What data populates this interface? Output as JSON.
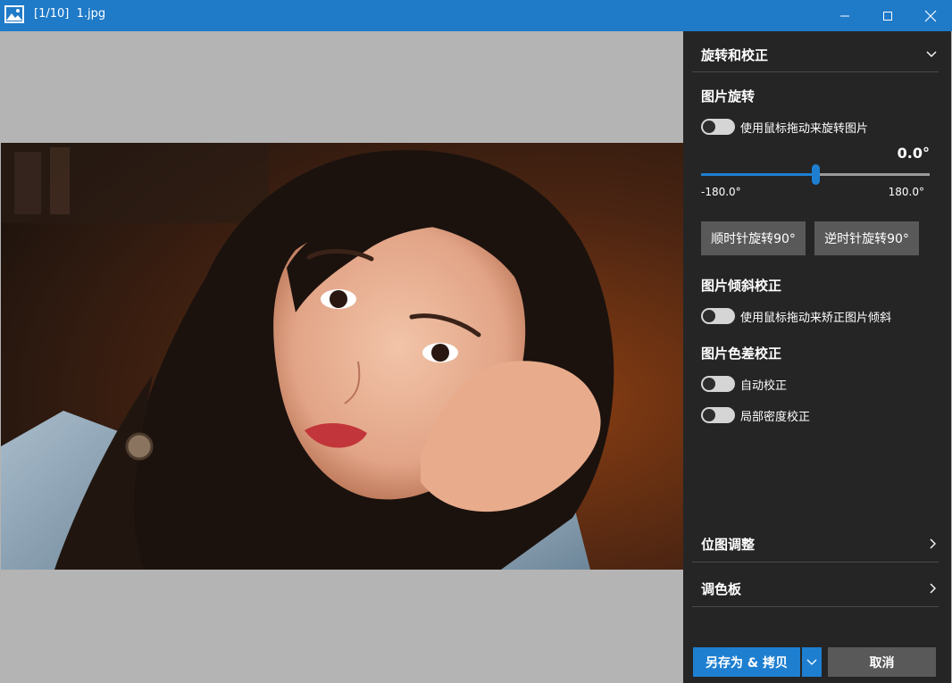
{
  "window": {
    "counter": "[1/10]",
    "filename": "1.jpg",
    "icons": {
      "app": "image-icon",
      "minimize": "minimize-icon",
      "maximize": "maximize-icon",
      "close": "close-icon"
    }
  },
  "colors": {
    "titlebar": "#1f7ac8",
    "accent": "#1e7fd1",
    "panel": "#252526",
    "button": "#595959",
    "viewer_bg": "#b4b4b4"
  },
  "panel": {
    "rotate_section": {
      "title": "旋转和校正",
      "expanded": true,
      "rotation": {
        "title": "图片旋转",
        "mouse_toggle_label": "使用鼠标拖动来旋转图片",
        "mouse_toggle_on": false,
        "angle_display": "0.0°",
        "angle": 0.0,
        "min_label": "-180.0°",
        "max_label": "180.0°",
        "min": -180,
        "max": 180,
        "cw_button": "顺时针旋转90°",
        "ccw_button": "逆时针旋转90°"
      },
      "skew": {
        "title": "图片倾斜校正",
        "mouse_toggle_label": "使用鼠标拖动来矫正图片倾斜",
        "mouse_toggle_on": false
      },
      "chromatic": {
        "title": "图片色差校正",
        "auto_label": "自动校正",
        "auto_on": false,
        "local_label": "局部密度校正",
        "local_on": false
      }
    },
    "bitmap_section": {
      "title": "位图调整",
      "expanded": false
    },
    "palette_section": {
      "title": "调色板",
      "expanded": false
    },
    "actions": {
      "save_copy": "另存为 & 拷贝",
      "cancel": "取消"
    }
  }
}
